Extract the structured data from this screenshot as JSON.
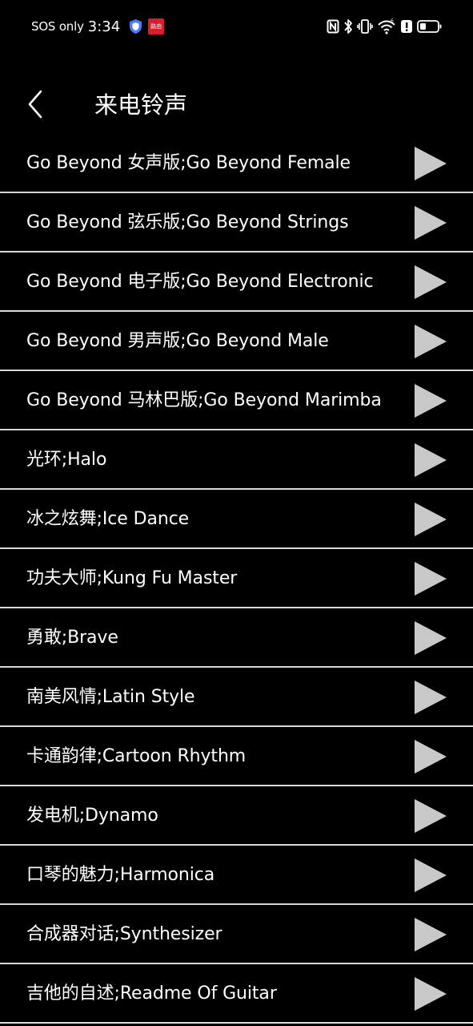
{
  "status_bar": {
    "carrier": "SOS only",
    "time": "3:34",
    "app_badge": "路由"
  },
  "header": {
    "title": "来电铃声"
  },
  "ringtones": [
    {
      "label": "Go Beyond 女声版;Go Beyond Female"
    },
    {
      "label": "Go Beyond 弦乐版;Go Beyond Strings"
    },
    {
      "label": "Go Beyond 电子版;Go Beyond Electronic"
    },
    {
      "label": "Go Beyond 男声版;Go Beyond Male"
    },
    {
      "label": "Go Beyond 马林巴版;Go Beyond Marimba"
    },
    {
      "label": "光环;Halo"
    },
    {
      "label": "冰之炫舞;Ice Dance"
    },
    {
      "label": "功夫大师;Kung Fu Master"
    },
    {
      "label": "勇敢;Brave"
    },
    {
      "label": "南美风情;Latin Style"
    },
    {
      "label": "卡通韵律;Cartoon Rhythm"
    },
    {
      "label": "发电机;Dynamo"
    },
    {
      "label": "口琴的魅力;Harmonica"
    },
    {
      "label": "合成器对话;Synthesizer"
    },
    {
      "label": "吉他的自述;Readme Of Guitar"
    }
  ],
  "icons": {
    "back": "chevron-left-icon",
    "play": "play-icon",
    "nfc": "nfc-icon",
    "bluetooth": "bluetooth-icon",
    "vibrate": "vibrate-icon",
    "wifi": "wifi-icon",
    "alert": "alert-icon",
    "battery": "battery-icon",
    "shield": "shield-icon"
  },
  "colors": {
    "background": "#000000",
    "text": "#ffffff",
    "divider": "#d8d8d8",
    "play_icon": "#c8c8c8",
    "shield": "#4a7cf5",
    "app_badge": "#d81e2c"
  }
}
